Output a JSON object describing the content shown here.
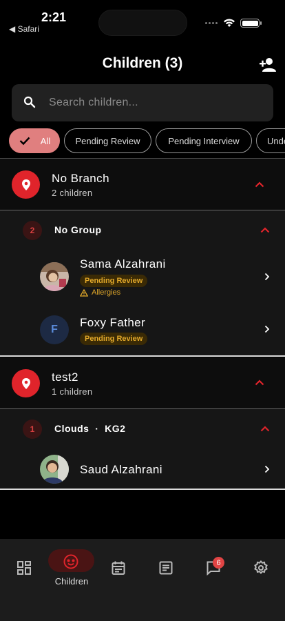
{
  "status_bar": {
    "time": "2:21",
    "back_app": "◀ Safari"
  },
  "header": {
    "title": "Children (3)",
    "add_icon": "person-add-icon"
  },
  "search": {
    "placeholder": "Search children..."
  },
  "filters": [
    {
      "label": "All",
      "active": true
    },
    {
      "label": "Pending Review",
      "active": false
    },
    {
      "label": "Pending Interview",
      "active": false
    },
    {
      "label": "Unde",
      "active": false
    }
  ],
  "branches": [
    {
      "name": "No Branch",
      "count": "2 children",
      "groups": [
        {
          "badge": "2",
          "name": "No Group",
          "children": [
            {
              "name": "Sama Alzahrani",
              "status": "Pending Review",
              "allergy": "Allergies",
              "avatar": "photo"
            },
            {
              "name": "Foxy Father",
              "status": "Pending Review",
              "avatar_initial": "F"
            }
          ]
        }
      ]
    },
    {
      "name": "test2",
      "count": "1 children",
      "groups": [
        {
          "badge": "1",
          "name": "Clouds  ·  KG2",
          "children": [
            {
              "name": "Saud Alzahrani",
              "avatar": "photo"
            }
          ]
        }
      ]
    }
  ],
  "bottom_nav": {
    "active_label": "Children",
    "messages_badge": "6",
    "items": [
      "dashboard-icon",
      "child-face-icon",
      "calendar-icon",
      "notes-icon",
      "chat-icon",
      "settings-icon"
    ]
  },
  "colors": {
    "accent": "#e0242b",
    "pending": "#e1a82a",
    "chip_active": "#e07f7f"
  }
}
